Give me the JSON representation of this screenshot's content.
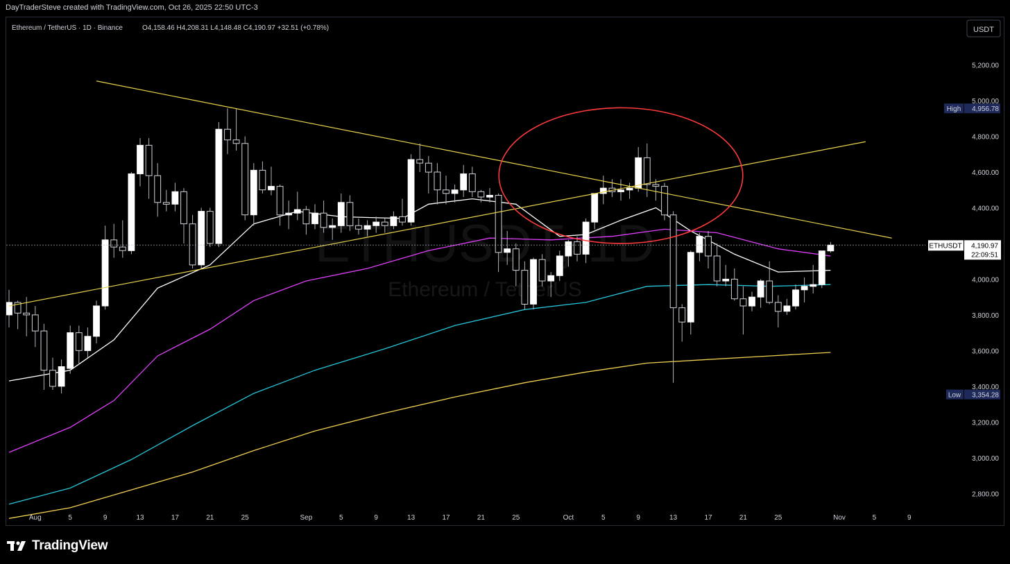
{
  "header": {
    "attribution": "DayTraderSteve created with TradingView.com, Oct 26, 2025 22:50 UTC-3",
    "symbol_line": "Ethereum / TetherUS · 1D · Binance",
    "ohlc": "O4,158.46  H4,208.31  L4,148.48  C4,190.97  +32.51 (+0.78%)",
    "currency_button": "USDT"
  },
  "watermark": {
    "ticker": "ETHUSDT, 1D",
    "name": "Ethereum / TetherUS"
  },
  "price_axis": {
    "ticks": [
      "5,200.00",
      "5,000.00",
      "4,800.00",
      "4,600.00",
      "4,400.00",
      "4,000.00",
      "3,800.00",
      "3,600.00",
      "3,400.00",
      "3,200.00",
      "3,000.00",
      "2,800.00"
    ],
    "high_label": "High",
    "high_value": "4,956.78",
    "low_label": "Low",
    "low_value": "3,354.28",
    "last_symbol": "ETHUSDT",
    "last_price": "4,190.97",
    "countdown": "22:09:51"
  },
  "time_axis": {
    "ticks": [
      "Aug",
      "5",
      "9",
      "13",
      "17",
      "21",
      "25",
      "Sep",
      "5",
      "9",
      "13",
      "17",
      "21",
      "25",
      "Oct",
      "5",
      "9",
      "13",
      "17",
      "21",
      "25",
      "Nov",
      "5",
      "9"
    ]
  },
  "brand": {
    "name": "TradingView"
  },
  "colors": {
    "bg": "#000000",
    "up_body": "#ffffff",
    "wick": "#b2b5be",
    "ma_short": "#ffffff",
    "ma_magenta": "#e040fb",
    "ma_cyan": "#26c6da",
    "ma_yellow": "#f0d050",
    "trendline": "#e8d44d",
    "circle": "#ff3b3b",
    "text": "#d1d4dc"
  },
  "chart_data": {
    "type": "candlestick",
    "symbol": "ETHUSDT",
    "timeframe": "1D",
    "ylim": [
      2700,
      5350
    ],
    "date_range": [
      "2025-07-29",
      "2025-11-11"
    ],
    "candles": [
      {
        "d": "2025-07-29",
        "o": 3800,
        "h": 3940,
        "l": 3730,
        "c": 3870
      },
      {
        "d": "2025-07-30",
        "o": 3870,
        "h": 3880,
        "l": 3720,
        "c": 3810
      },
      {
        "d": "2025-07-31",
        "o": 3810,
        "h": 3900,
        "l": 3680,
        "c": 3800
      },
      {
        "d": "2025-08-01",
        "o": 3800,
        "h": 3850,
        "l": 3620,
        "c": 3710
      },
      {
        "d": "2025-08-02",
        "o": 3710,
        "h": 3750,
        "l": 3380,
        "c": 3490
      },
      {
        "d": "2025-08-03",
        "o": 3490,
        "h": 3560,
        "l": 3380,
        "c": 3400
      },
      {
        "d": "2025-08-04",
        "o": 3400,
        "h": 3550,
        "l": 3360,
        "c": 3510
      },
      {
        "d": "2025-08-05",
        "o": 3500,
        "h": 3740,
        "l": 3470,
        "c": 3700
      },
      {
        "d": "2025-08-06",
        "o": 3700,
        "h": 3740,
        "l": 3520,
        "c": 3600
      },
      {
        "d": "2025-08-07",
        "o": 3600,
        "h": 3730,
        "l": 3560,
        "c": 3680
      },
      {
        "d": "2025-08-08",
        "o": 3680,
        "h": 3880,
        "l": 3640,
        "c": 3850
      },
      {
        "d": "2025-08-09",
        "o": 3850,
        "h": 4300,
        "l": 3830,
        "c": 4220
      },
      {
        "d": "2025-08-10",
        "o": 4220,
        "h": 4310,
        "l": 4120,
        "c": 4180
      },
      {
        "d": "2025-08-11",
        "o": 4180,
        "h": 4330,
        "l": 4120,
        "c": 4160
      },
      {
        "d": "2025-08-12",
        "o": 4160,
        "h": 4600,
        "l": 4140,
        "c": 4590
      },
      {
        "d": "2025-08-13",
        "o": 4590,
        "h": 4790,
        "l": 4520,
        "c": 4750
      },
      {
        "d": "2025-08-14",
        "o": 4750,
        "h": 4790,
        "l": 4450,
        "c": 4580
      },
      {
        "d": "2025-08-15",
        "o": 4580,
        "h": 4650,
        "l": 4350,
        "c": 4430
      },
      {
        "d": "2025-08-16",
        "o": 4430,
        "h": 4500,
        "l": 4380,
        "c": 4420
      },
      {
        "d": "2025-08-17",
        "o": 4420,
        "h": 4540,
        "l": 4380,
        "c": 4490
      },
      {
        "d": "2025-08-18",
        "o": 4490,
        "h": 4510,
        "l": 4200,
        "c": 4310
      },
      {
        "d": "2025-08-19",
        "o": 4310,
        "h": 4360,
        "l": 4060,
        "c": 4080
      },
      {
        "d": "2025-08-20",
        "o": 4080,
        "h": 4400,
        "l": 4060,
        "c": 4380
      },
      {
        "d": "2025-08-21",
        "o": 4380,
        "h": 4400,
        "l": 4180,
        "c": 4200
      },
      {
        "d": "2025-08-22",
        "o": 4200,
        "h": 4880,
        "l": 4180,
        "c": 4840
      },
      {
        "d": "2025-08-23",
        "o": 4840,
        "h": 4957,
        "l": 4700,
        "c": 4780
      },
      {
        "d": "2025-08-24",
        "o": 4780,
        "h": 4957,
        "l": 4720,
        "c": 4760
      },
      {
        "d": "2025-08-25",
        "o": 4760,
        "h": 4800,
        "l": 4330,
        "c": 4360
      },
      {
        "d": "2025-08-26",
        "o": 4360,
        "h": 4650,
        "l": 4300,
        "c": 4610
      },
      {
        "d": "2025-08-27",
        "o": 4610,
        "h": 4660,
        "l": 4480,
        "c": 4500
      },
      {
        "d": "2025-08-28",
        "o": 4500,
        "h": 4630,
        "l": 4470,
        "c": 4520
      },
      {
        "d": "2025-08-29",
        "o": 4520,
        "h": 4530,
        "l": 4300,
        "c": 4360
      },
      {
        "d": "2025-08-30",
        "o": 4360,
        "h": 4440,
        "l": 4280,
        "c": 4370
      },
      {
        "d": "2025-08-31",
        "o": 4370,
        "h": 4490,
        "l": 4330,
        "c": 4390
      },
      {
        "d": "2025-09-01",
        "o": 4390,
        "h": 4410,
        "l": 4250,
        "c": 4310
      },
      {
        "d": "2025-09-02",
        "o": 4310,
        "h": 4420,
        "l": 4280,
        "c": 4370
      },
      {
        "d": "2025-09-03",
        "o": 4370,
        "h": 4440,
        "l": 4260,
        "c": 4290
      },
      {
        "d": "2025-09-04",
        "o": 4290,
        "h": 4340,
        "l": 4220,
        "c": 4300
      },
      {
        "d": "2025-09-05",
        "o": 4300,
        "h": 4480,
        "l": 4260,
        "c": 4430
      },
      {
        "d": "2025-09-06",
        "o": 4430,
        "h": 4470,
        "l": 4270,
        "c": 4300
      },
      {
        "d": "2025-09-07",
        "o": 4300,
        "h": 4340,
        "l": 4250,
        "c": 4280
      },
      {
        "d": "2025-09-08",
        "o": 4280,
        "h": 4330,
        "l": 4240,
        "c": 4300
      },
      {
        "d": "2025-09-09",
        "o": 4300,
        "h": 4350,
        "l": 4260,
        "c": 4320
      },
      {
        "d": "2025-09-10",
        "o": 4320,
        "h": 4340,
        "l": 4260,
        "c": 4300
      },
      {
        "d": "2025-09-11",
        "o": 4300,
        "h": 4380,
        "l": 4280,
        "c": 4350
      },
      {
        "d": "2025-09-12",
        "o": 4350,
        "h": 4450,
        "l": 4300,
        "c": 4320
      },
      {
        "d": "2025-09-13",
        "o": 4320,
        "h": 4700,
        "l": 4300,
        "c": 4670
      },
      {
        "d": "2025-09-14",
        "o": 4670,
        "h": 4760,
        "l": 4600,
        "c": 4650
      },
      {
        "d": "2025-09-15",
        "o": 4650,
        "h": 4690,
        "l": 4480,
        "c": 4600
      },
      {
        "d": "2025-09-16",
        "o": 4600,
        "h": 4650,
        "l": 4420,
        "c": 4500
      },
      {
        "d": "2025-09-17",
        "o": 4500,
        "h": 4580,
        "l": 4420,
        "c": 4480
      },
      {
        "d": "2025-09-18",
        "o": 4480,
        "h": 4530,
        "l": 4430,
        "c": 4500
      },
      {
        "d": "2025-09-19",
        "o": 4500,
        "h": 4640,
        "l": 4460,
        "c": 4590
      },
      {
        "d": "2025-09-20",
        "o": 4590,
        "h": 4630,
        "l": 4460,
        "c": 4490
      },
      {
        "d": "2025-09-21",
        "o": 4490,
        "h": 4500,
        "l": 4430,
        "c": 4460
      },
      {
        "d": "2025-09-22",
        "o": 4460,
        "h": 4510,
        "l": 4430,
        "c": 4470
      },
      {
        "d": "2025-09-23",
        "o": 4470,
        "h": 4480,
        "l": 4040,
        "c": 4150
      },
      {
        "d": "2025-09-24",
        "o": 4150,
        "h": 4270,
        "l": 4080,
        "c": 4170
      },
      {
        "d": "2025-09-25",
        "o": 4170,
        "h": 4200,
        "l": 3960,
        "c": 4050
      },
      {
        "d": "2025-09-26",
        "o": 4050,
        "h": 4100,
        "l": 3830,
        "c": 3860
      },
      {
        "d": "2025-09-27",
        "o": 3860,
        "h": 4120,
        "l": 3830,
        "c": 4110
      },
      {
        "d": "2025-09-28",
        "o": 4110,
        "h": 4140,
        "l": 3960,
        "c": 3990
      },
      {
        "d": "2025-09-29",
        "o": 3990,
        "h": 4040,
        "l": 3900,
        "c": 4020
      },
      {
        "d": "2025-09-30",
        "o": 4020,
        "h": 4160,
        "l": 3990,
        "c": 4130
      },
      {
        "d": "2025-10-01",
        "o": 4130,
        "h": 4220,
        "l": 4070,
        "c": 4210
      },
      {
        "d": "2025-10-02",
        "o": 4210,
        "h": 4240,
        "l": 4100,
        "c": 4140
      },
      {
        "d": "2025-10-03",
        "o": 4140,
        "h": 4340,
        "l": 4090,
        "c": 4320
      },
      {
        "d": "2025-10-04",
        "o": 4320,
        "h": 4480,
        "l": 4280,
        "c": 4480
      },
      {
        "d": "2025-10-05",
        "o": 4480,
        "h": 4580,
        "l": 4420,
        "c": 4510
      },
      {
        "d": "2025-10-06",
        "o": 4510,
        "h": 4560,
        "l": 4460,
        "c": 4490
      },
      {
        "d": "2025-10-07",
        "o": 4490,
        "h": 4560,
        "l": 4440,
        "c": 4500
      },
      {
        "d": "2025-10-08",
        "o": 4500,
        "h": 4540,
        "l": 4450,
        "c": 4510
      },
      {
        "d": "2025-10-09",
        "o": 4510,
        "h": 4740,
        "l": 4490,
        "c": 4680
      },
      {
        "d": "2025-10-10",
        "o": 4680,
        "h": 4760,
        "l": 4460,
        "c": 4530
      },
      {
        "d": "2025-10-11",
        "o": 4530,
        "h": 4560,
        "l": 4440,
        "c": 4520
      },
      {
        "d": "2025-10-12",
        "o": 4520,
        "h": 4540,
        "l": 4330,
        "c": 4360
      },
      {
        "d": "2025-10-13",
        "o": 4360,
        "h": 4380,
        "l": 3420,
        "c": 3840
      },
      {
        "d": "2025-10-14",
        "o": 3840,
        "h": 3860,
        "l": 3650,
        "c": 3760
      },
      {
        "d": "2025-10-15",
        "o": 3760,
        "h": 4160,
        "l": 3690,
        "c": 4150
      },
      {
        "d": "2025-10-16",
        "o": 4150,
        "h": 4260,
        "l": 4100,
        "c": 4240
      },
      {
        "d": "2025-10-17",
        "o": 4240,
        "h": 4270,
        "l": 4060,
        "c": 4130
      },
      {
        "d": "2025-10-18",
        "o": 4130,
        "h": 4200,
        "l": 3960,
        "c": 3990
      },
      {
        "d": "2025-10-19",
        "o": 3990,
        "h": 4080,
        "l": 3960,
        "c": 4000
      },
      {
        "d": "2025-10-20",
        "o": 4000,
        "h": 4060,
        "l": 3880,
        "c": 3890
      },
      {
        "d": "2025-10-21",
        "o": 3890,
        "h": 3960,
        "l": 3690,
        "c": 3850
      },
      {
        "d": "2025-10-22",
        "o": 3850,
        "h": 3930,
        "l": 3820,
        "c": 3900
      },
      {
        "d": "2025-10-23",
        "o": 3900,
        "h": 4000,
        "l": 3840,
        "c": 3990
      },
      {
        "d": "2025-10-24",
        "o": 3990,
        "h": 4100,
        "l": 3860,
        "c": 3870
      },
      {
        "d": "2025-10-25",
        "o": 3870,
        "h": 3910,
        "l": 3730,
        "c": 3820
      },
      {
        "d": "2025-10-26",
        "o": 3820,
        "h": 3890,
        "l": 3800,
        "c": 3850
      },
      {
        "d": "2025-10-27",
        "o": 3850,
        "h": 3970,
        "l": 3830,
        "c": 3940
      },
      {
        "d": "2025-10-28",
        "o": 3940,
        "h": 4010,
        "l": 3870,
        "c": 3960
      },
      {
        "d": "2025-10-29",
        "o": 3960,
        "h": 4080,
        "l": 3920,
        "c": 3970
      },
      {
        "d": "2025-10-30",
        "o": 3970,
        "h": 4150,
        "l": 3950,
        "c": 4158.46
      },
      {
        "d": "2025-10-31",
        "o": 4158.46,
        "h": 4208.31,
        "l": 4148.48,
        "c": 4190.97
      }
    ],
    "moving_averages": [
      {
        "color": "#ffffff",
        "points": [
          [
            "2025-07-29",
            3430
          ],
          [
            "2025-08-05",
            3490
          ],
          [
            "2025-08-10",
            3660
          ],
          [
            "2025-08-15",
            3950
          ],
          [
            "2025-08-21",
            4080
          ],
          [
            "2025-08-26",
            4310
          ],
          [
            "2025-08-31",
            4380
          ],
          [
            "2025-09-05",
            4350
          ],
          [
            "2025-09-12",
            4340
          ],
          [
            "2025-09-15",
            4420
          ],
          [
            "2025-09-20",
            4450
          ],
          [
            "2025-09-25",
            4420
          ],
          [
            "2025-09-30",
            4240
          ],
          [
            "2025-10-03",
            4250
          ],
          [
            "2025-10-07",
            4330
          ],
          [
            "2025-10-11",
            4400
          ],
          [
            "2025-10-15",
            4270
          ],
          [
            "2025-10-20",
            4140
          ],
          [
            "2025-10-25",
            4040
          ],
          [
            "2025-10-31",
            4050
          ]
        ]
      },
      {
        "color": "#e040fb",
        "points": [
          [
            "2025-07-29",
            3030
          ],
          [
            "2025-08-05",
            3170
          ],
          [
            "2025-08-10",
            3320
          ],
          [
            "2025-08-15",
            3570
          ],
          [
            "2025-08-21",
            3720
          ],
          [
            "2025-08-26",
            3880
          ],
          [
            "2025-09-01",
            3990
          ],
          [
            "2025-09-08",
            4060
          ],
          [
            "2025-09-15",
            4160
          ],
          [
            "2025-09-22",
            4230
          ],
          [
            "2025-09-29",
            4220
          ],
          [
            "2025-10-06",
            4240
          ],
          [
            "2025-10-12",
            4280
          ],
          [
            "2025-10-18",
            4260
          ],
          [
            "2025-10-25",
            4170
          ],
          [
            "2025-10-31",
            4130
          ]
        ]
      },
      {
        "color": "#26c6da",
        "points": [
          [
            "2025-07-29",
            2740
          ],
          [
            "2025-08-05",
            2830
          ],
          [
            "2025-08-12",
            2990
          ],
          [
            "2025-08-19",
            3180
          ],
          [
            "2025-08-26",
            3360
          ],
          [
            "2025-09-02",
            3490
          ],
          [
            "2025-09-10",
            3610
          ],
          [
            "2025-09-18",
            3740
          ],
          [
            "2025-09-26",
            3830
          ],
          [
            "2025-10-03",
            3870
          ],
          [
            "2025-10-10",
            3960
          ],
          [
            "2025-10-17",
            3970
          ],
          [
            "2025-10-24",
            3960
          ],
          [
            "2025-10-31",
            3970
          ]
        ]
      },
      {
        "color": "#f0d050",
        "points": [
          [
            "2025-07-29",
            2660
          ],
          [
            "2025-08-05",
            2720
          ],
          [
            "2025-08-12",
            2820
          ],
          [
            "2025-08-19",
            2920
          ],
          [
            "2025-08-26",
            3040
          ],
          [
            "2025-09-02",
            3150
          ],
          [
            "2025-09-10",
            3250
          ],
          [
            "2025-09-18",
            3340
          ],
          [
            "2025-09-26",
            3420
          ],
          [
            "2025-10-03",
            3480
          ],
          [
            "2025-10-10",
            3530
          ],
          [
            "2025-10-17",
            3550
          ],
          [
            "2025-10-24",
            3570
          ],
          [
            "2025-10-31",
            3590
          ]
        ]
      }
    ],
    "trendlines": [
      {
        "color": "#e8d44d",
        "from": [
          "2025-08-08",
          5110
        ],
        "to": [
          "2025-11-07",
          4230
        ]
      },
      {
        "color": "#e8d44d",
        "from": [
          "2025-07-29",
          3850
        ],
        "to": [
          "2025-11-04",
          4770
        ]
      }
    ],
    "highlight_ellipse": {
      "color": "#ff3b3b",
      "center": [
        "2025-10-07",
        4580
      ],
      "rx_days": 9,
      "ry_price": 190
    }
  }
}
